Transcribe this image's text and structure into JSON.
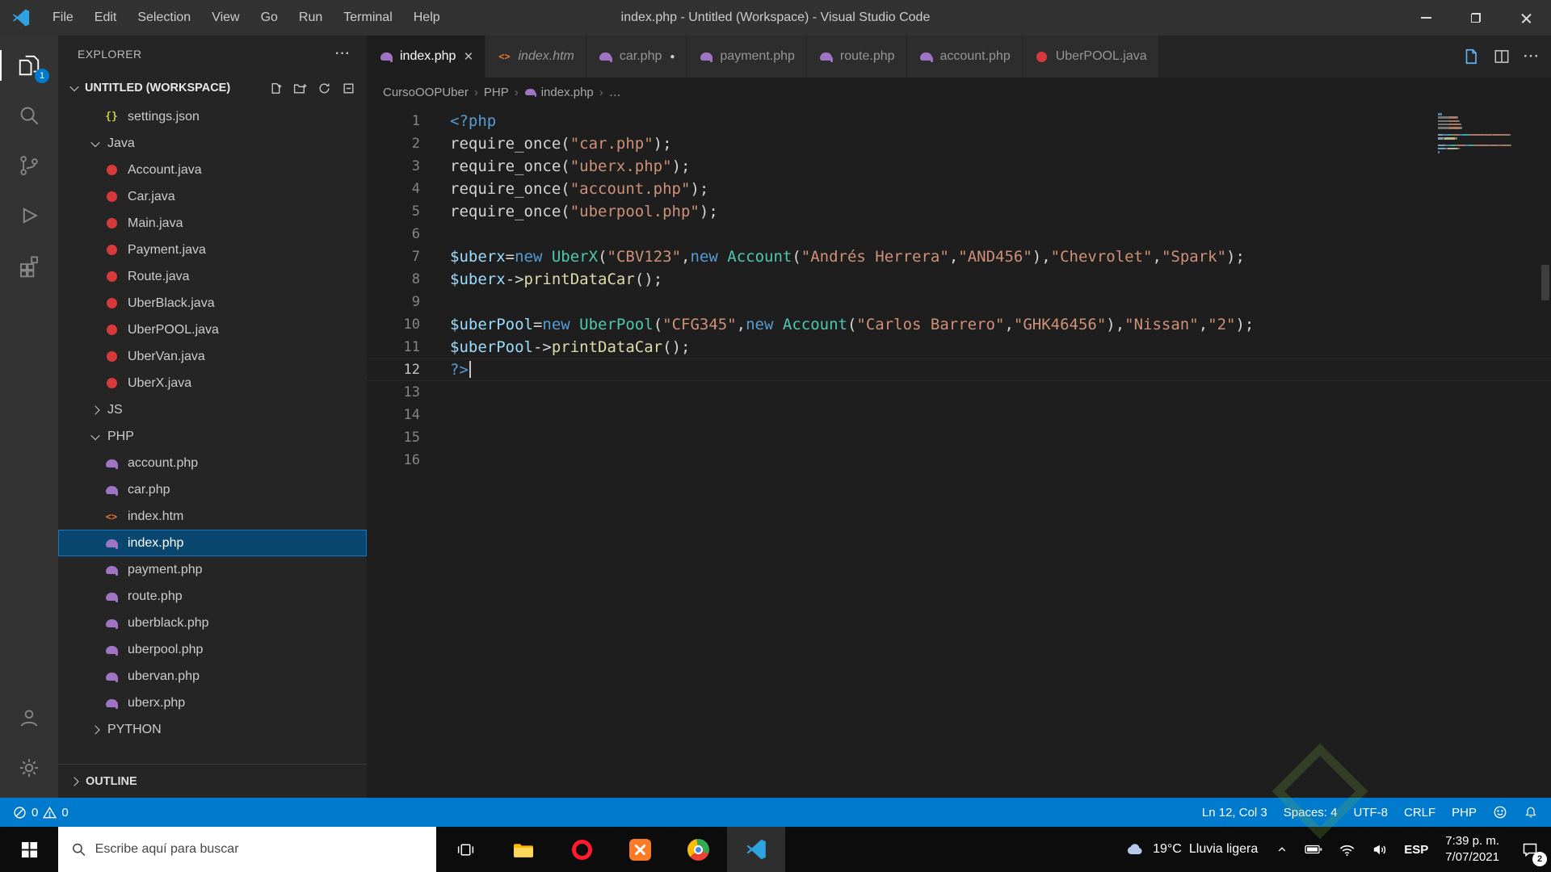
{
  "colors": {
    "accent": "#007acc",
    "selection": "#094771",
    "php_icon": "#a074c4",
    "java_icon": "#d63a3a"
  },
  "window": {
    "title": "index.php - Untitled (Workspace) - Visual Studio Code",
    "menus": [
      "File",
      "Edit",
      "Selection",
      "View",
      "Go",
      "Run",
      "Terminal",
      "Help"
    ]
  },
  "activity_bar": {
    "explorer_badge": "1"
  },
  "sidebar": {
    "title": "EXPLORER",
    "workspace_label": "UNTITLED (WORKSPACE)",
    "outline_label": "OUTLINE",
    "tree": [
      {
        "label": "settings.json",
        "type": "file",
        "icon": "json"
      },
      {
        "label": "Java",
        "type": "folder",
        "expanded": true
      },
      {
        "label": "Account.java",
        "type": "file",
        "icon": "java"
      },
      {
        "label": "Car.java",
        "type": "file",
        "icon": "java"
      },
      {
        "label": "Main.java",
        "type": "file",
        "icon": "java"
      },
      {
        "label": "Payment.java",
        "type": "file",
        "icon": "java"
      },
      {
        "label": "Route.java",
        "type": "file",
        "icon": "java"
      },
      {
        "label": "UberBlack.java",
        "type": "file",
        "icon": "java"
      },
      {
        "label": "UberPOOL.java",
        "type": "file",
        "icon": "java"
      },
      {
        "label": "UberVan.java",
        "type": "file",
        "icon": "java"
      },
      {
        "label": "UberX.java",
        "type": "file",
        "icon": "java"
      },
      {
        "label": "JS",
        "type": "folder",
        "expanded": false
      },
      {
        "label": "PHP",
        "type": "folder",
        "expanded": true
      },
      {
        "label": "account.php",
        "type": "file",
        "icon": "php"
      },
      {
        "label": "car.php",
        "type": "file",
        "icon": "php"
      },
      {
        "label": "index.htm",
        "type": "file",
        "icon": "html"
      },
      {
        "label": "index.php",
        "type": "file",
        "icon": "php",
        "selected": true
      },
      {
        "label": "payment.php",
        "type": "file",
        "icon": "php"
      },
      {
        "label": "route.php",
        "type": "file",
        "icon": "php"
      },
      {
        "label": "uberblack.php",
        "type": "file",
        "icon": "php"
      },
      {
        "label": "uberpool.php",
        "type": "file",
        "icon": "php"
      },
      {
        "label": "ubervan.php",
        "type": "file",
        "icon": "php"
      },
      {
        "label": "uberx.php",
        "type": "file",
        "icon": "php"
      },
      {
        "label": "PYTHON",
        "type": "folder",
        "expanded": false
      }
    ]
  },
  "tabs": [
    {
      "label": "index.php",
      "icon": "php",
      "active": true
    },
    {
      "label": "index.htm",
      "icon": "html",
      "preview": true
    },
    {
      "label": "car.php",
      "icon": "php",
      "modified": true
    },
    {
      "label": "payment.php",
      "icon": "php"
    },
    {
      "label": "route.php",
      "icon": "php"
    },
    {
      "label": "account.php",
      "icon": "php"
    },
    {
      "label": "UberPOOL.java",
      "icon": "java"
    }
  ],
  "breadcrumbs": [
    {
      "label": "CursoOOPUber"
    },
    {
      "label": "PHP"
    },
    {
      "label": "index.php",
      "icon": "php"
    },
    {
      "label": "…"
    }
  ],
  "editor": {
    "lines": [
      {
        "n": 1,
        "tokens": [
          [
            "<?php",
            "kw"
          ]
        ]
      },
      {
        "n": 2,
        "tokens": [
          [
            "require_once(",
            "pln"
          ],
          [
            "\"car.php\"",
            "str"
          ],
          [
            ");",
            "pln"
          ]
        ]
      },
      {
        "n": 3,
        "tokens": [
          [
            "require_once(",
            "pln"
          ],
          [
            "\"uberx.php\"",
            "str"
          ],
          [
            ");",
            "pln"
          ]
        ]
      },
      {
        "n": 4,
        "tokens": [
          [
            "require_once(",
            "pln"
          ],
          [
            "\"account.php\"",
            "str"
          ],
          [
            ");",
            "pln"
          ]
        ]
      },
      {
        "n": 5,
        "tokens": [
          [
            "require_once(",
            "pln"
          ],
          [
            "\"uberpool.php\"",
            "str"
          ],
          [
            ");",
            "pln"
          ]
        ]
      },
      {
        "n": 6,
        "tokens": []
      },
      {
        "n": 7,
        "tokens": [
          [
            "$uberx",
            "var"
          ],
          [
            "=",
            "pln"
          ],
          [
            "new ",
            "kw"
          ],
          [
            "UberX",
            "cls"
          ],
          [
            "(",
            "pln"
          ],
          [
            "\"CBV123\"",
            "str"
          ],
          [
            ",",
            "pln"
          ],
          [
            "new ",
            "kw"
          ],
          [
            "Account",
            "cls"
          ],
          [
            "(",
            "pln"
          ],
          [
            "\"Andrés Herrera\"",
            "str"
          ],
          [
            ",",
            "pln"
          ],
          [
            "\"AND456\"",
            "str"
          ],
          [
            "),",
            "pln"
          ],
          [
            "\"Chevrolet\"",
            "str"
          ],
          [
            ",",
            "pln"
          ],
          [
            "\"Spark\"",
            "str"
          ],
          [
            ");",
            "pln"
          ]
        ]
      },
      {
        "n": 8,
        "tokens": [
          [
            "$uberx",
            "var"
          ],
          [
            "->",
            "pln"
          ],
          [
            "printDataCar",
            "fn"
          ],
          [
            "();",
            "pln"
          ]
        ]
      },
      {
        "n": 9,
        "tokens": []
      },
      {
        "n": 10,
        "tokens": [
          [
            "$uberPool",
            "var"
          ],
          [
            "=",
            "pln"
          ],
          [
            "new ",
            "kw"
          ],
          [
            "UberPool",
            "cls"
          ],
          [
            "(",
            "pln"
          ],
          [
            "\"CFG345\"",
            "str"
          ],
          [
            ",",
            "pln"
          ],
          [
            "new ",
            "kw"
          ],
          [
            "Account",
            "cls"
          ],
          [
            "(",
            "pln"
          ],
          [
            "\"Carlos Barrero\"",
            "str"
          ],
          [
            ",",
            "pln"
          ],
          [
            "\"GHK46456\"",
            "str"
          ],
          [
            "),",
            "pln"
          ],
          [
            "\"Nissan\"",
            "str"
          ],
          [
            ",",
            "pln"
          ],
          [
            "\"2\"",
            "str"
          ],
          [
            ");",
            "pln"
          ]
        ]
      },
      {
        "n": 11,
        "tokens": [
          [
            "$uberPool",
            "var"
          ],
          [
            "->",
            "pln"
          ],
          [
            "printDataCar",
            "fn"
          ],
          [
            "();",
            "pln"
          ]
        ]
      },
      {
        "n": 12,
        "tokens": [
          [
            "?>",
            "kw"
          ]
        ],
        "active": true,
        "cursor": true
      },
      {
        "n": 13,
        "tokens": []
      },
      {
        "n": 14,
        "tokens": []
      },
      {
        "n": 15,
        "tokens": []
      },
      {
        "n": 16,
        "tokens": []
      }
    ]
  },
  "status_bar": {
    "errors": "0",
    "warnings": "0",
    "cursor": "Ln 12, Col 3",
    "indent": "Spaces: 4",
    "encoding": "UTF-8",
    "eol": "CRLF",
    "language": "PHP"
  },
  "taskbar": {
    "search_placeholder": "Escribe aquí para buscar",
    "language": "ESP",
    "weather_temp": "19°C",
    "weather_desc": "Lluvia ligera",
    "time": "7:39 p. m.",
    "date": "7/07/2021",
    "notification_count": "2"
  }
}
